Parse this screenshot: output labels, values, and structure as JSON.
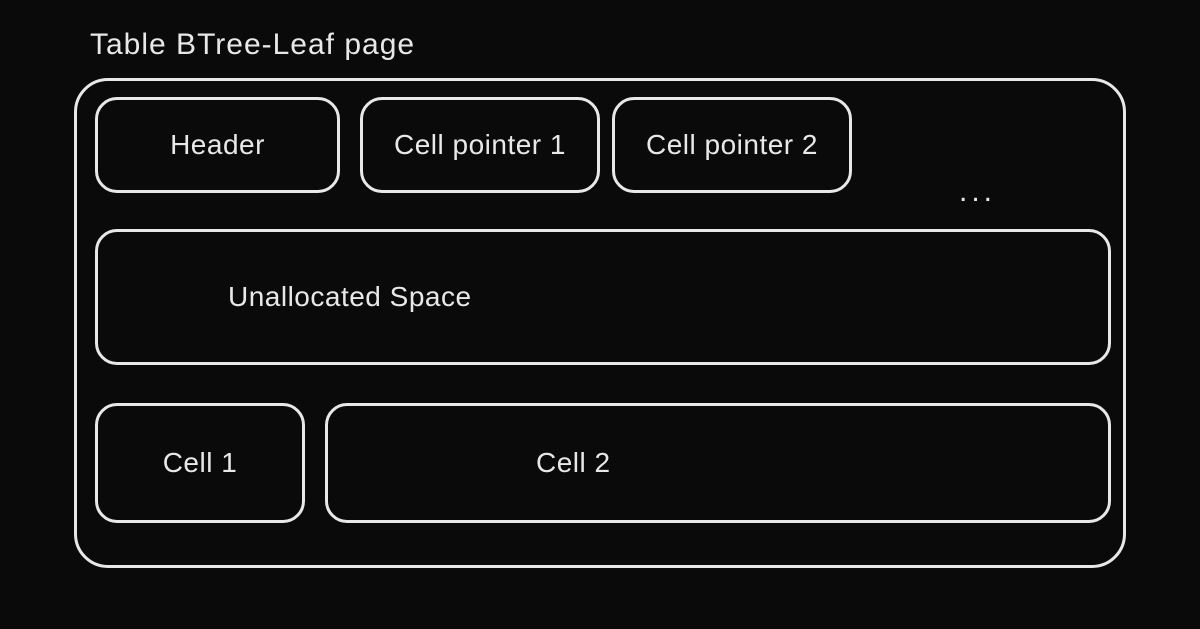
{
  "diagram": {
    "title": "Table BTree-Leaf page",
    "row1": {
      "header": "Header",
      "cell_pointer_1": "Cell pointer 1",
      "cell_pointer_2": "Cell pointer 2",
      "ellipsis": "..."
    },
    "row2": {
      "unallocated": "Unallocated Space"
    },
    "row3": {
      "cell_1": "Cell 1",
      "cell_2": "Cell 2"
    }
  }
}
